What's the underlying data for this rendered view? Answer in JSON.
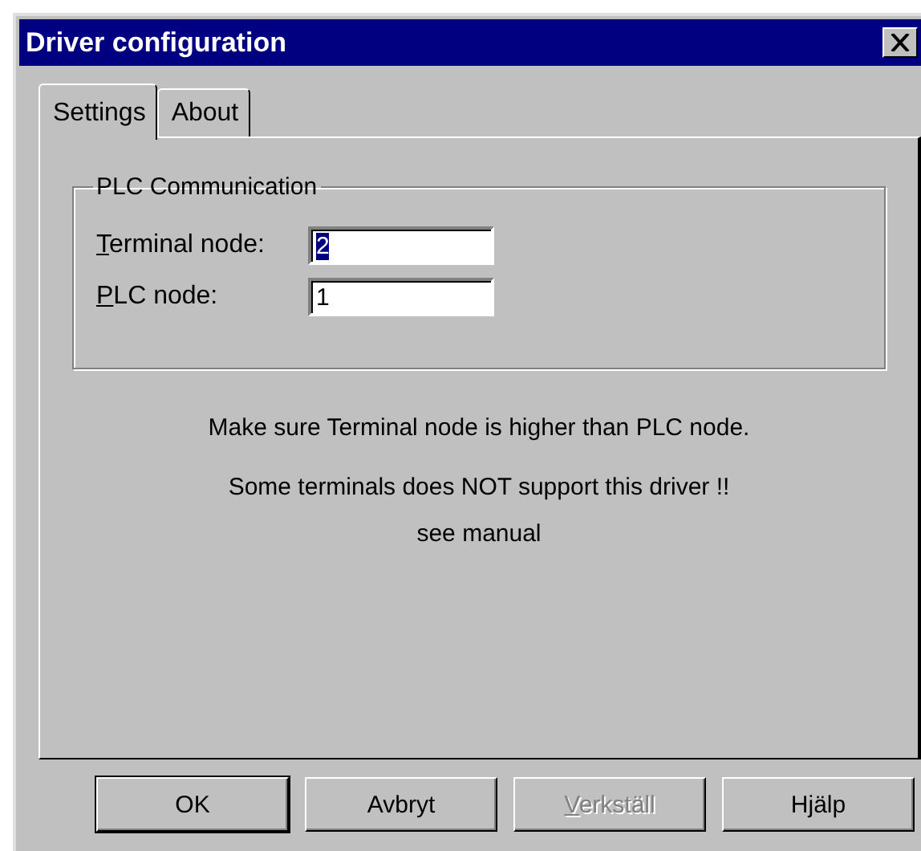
{
  "window": {
    "title": "Driver configuration"
  },
  "tabs": [
    {
      "label": "Settings",
      "selected": true
    },
    {
      "label": "About",
      "selected": false
    }
  ],
  "group": {
    "title": "PLC Communication",
    "fields": [
      {
        "label": "Terminal node:",
        "mnemonic_first": true,
        "value": "2",
        "value_selected": true
      },
      {
        "label": "PLC node:",
        "mnemonic_first": true,
        "value": "1",
        "value_selected": false
      }
    ]
  },
  "notes": [
    "Make sure Terminal node is higher than PLC node.",
    "Some terminals does NOT support this driver !!",
    "see manual"
  ],
  "buttons": [
    {
      "label": "OK",
      "default": true,
      "disabled": false,
      "mnemonic_first": false
    },
    {
      "label": "Avbryt",
      "default": false,
      "disabled": false,
      "mnemonic_first": false
    },
    {
      "label": "Verkställ",
      "default": false,
      "disabled": true,
      "mnemonic_first": true
    },
    {
      "label": "Hjälp",
      "default": false,
      "disabled": false,
      "mnemonic_first": false
    }
  ]
}
